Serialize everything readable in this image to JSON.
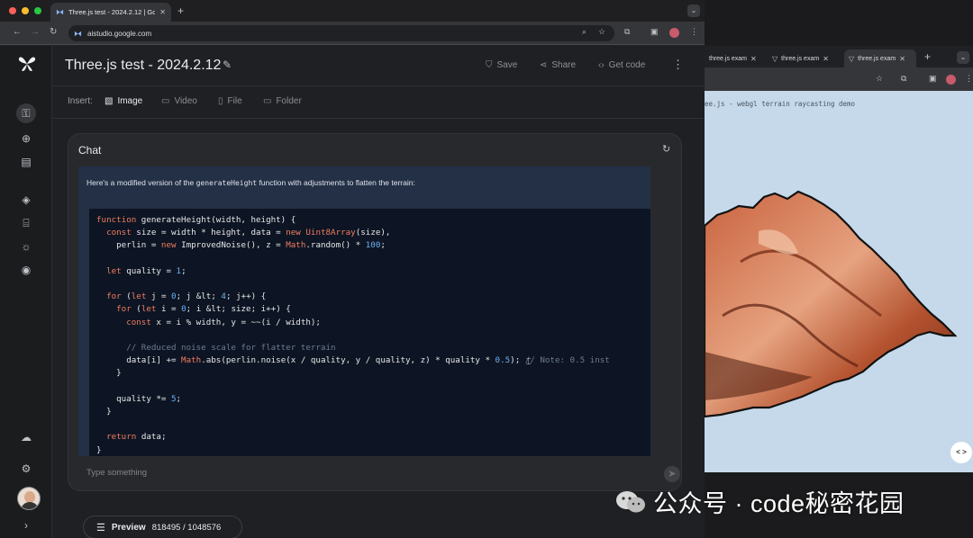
{
  "left_browser": {
    "tab_title": "Three.js test - 2024.2.12 | Go",
    "url": "aistudio.google.com"
  },
  "app": {
    "title": "Three.js test - 2024.2.12",
    "header_actions": {
      "save": "Save",
      "share": "Share",
      "get_code": "Get code"
    },
    "insert": {
      "label": "Insert:",
      "image": "Image",
      "video": "Video",
      "file": "File",
      "folder": "Folder"
    },
    "chat": {
      "title": "Chat",
      "message_prefix": "Here's a modified version of the ",
      "message_fn": "generateHeight",
      "message_suffix": " function with adjustments to flatten the terrain:",
      "input_placeholder": "Type something"
    },
    "preview": {
      "label": "Preview",
      "count": "818495 / 1048576"
    }
  },
  "right_browser": {
    "tabs": [
      "three.js exam",
      "three.js exam",
      "three.js exam"
    ],
    "page_title": "three.js - webgl terrain raycasting demo",
    "visible_title": "ee.js - webgl terrain raycasting demo",
    "toggle": "< >"
  },
  "watermark": {
    "text": "公众号 · code秘密花园"
  }
}
